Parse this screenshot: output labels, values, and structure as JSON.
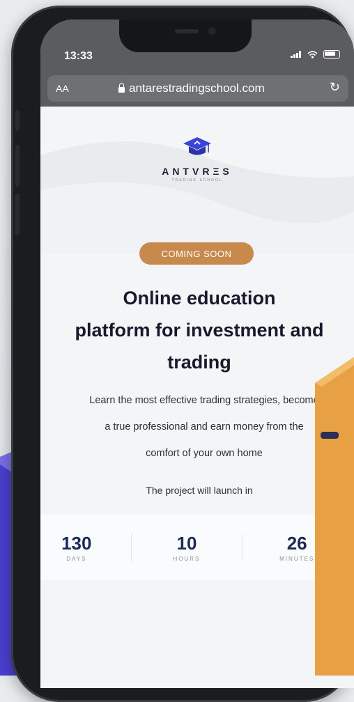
{
  "status_bar": {
    "time": "13:33"
  },
  "browser": {
    "aa_label": "AA",
    "url": "antarestradingschool.com"
  },
  "logo": {
    "brand": "ANTVRΞS",
    "subtitle": "TRADING SCHOOL"
  },
  "badge": {
    "label": "COMING SOON"
  },
  "headline": {
    "line1": "Online education",
    "line2": "platform for investment and",
    "line3": "trading"
  },
  "description": {
    "line1": "Learn the most effective trading strategies, become",
    "line2": "a true professional and earn money from the",
    "line3": "comfort of your own home"
  },
  "launch_text": "The project will launch in",
  "countdown": [
    {
      "value": "130",
      "label": "DAYS"
    },
    {
      "value": "10",
      "label": "HOURS"
    },
    {
      "value": "26",
      "label": "MINUTES"
    }
  ],
  "colors": {
    "accent": "#c8894c",
    "navy": "#1a2b55",
    "purple": "#5b4fd6",
    "orange": "#e7a043"
  }
}
